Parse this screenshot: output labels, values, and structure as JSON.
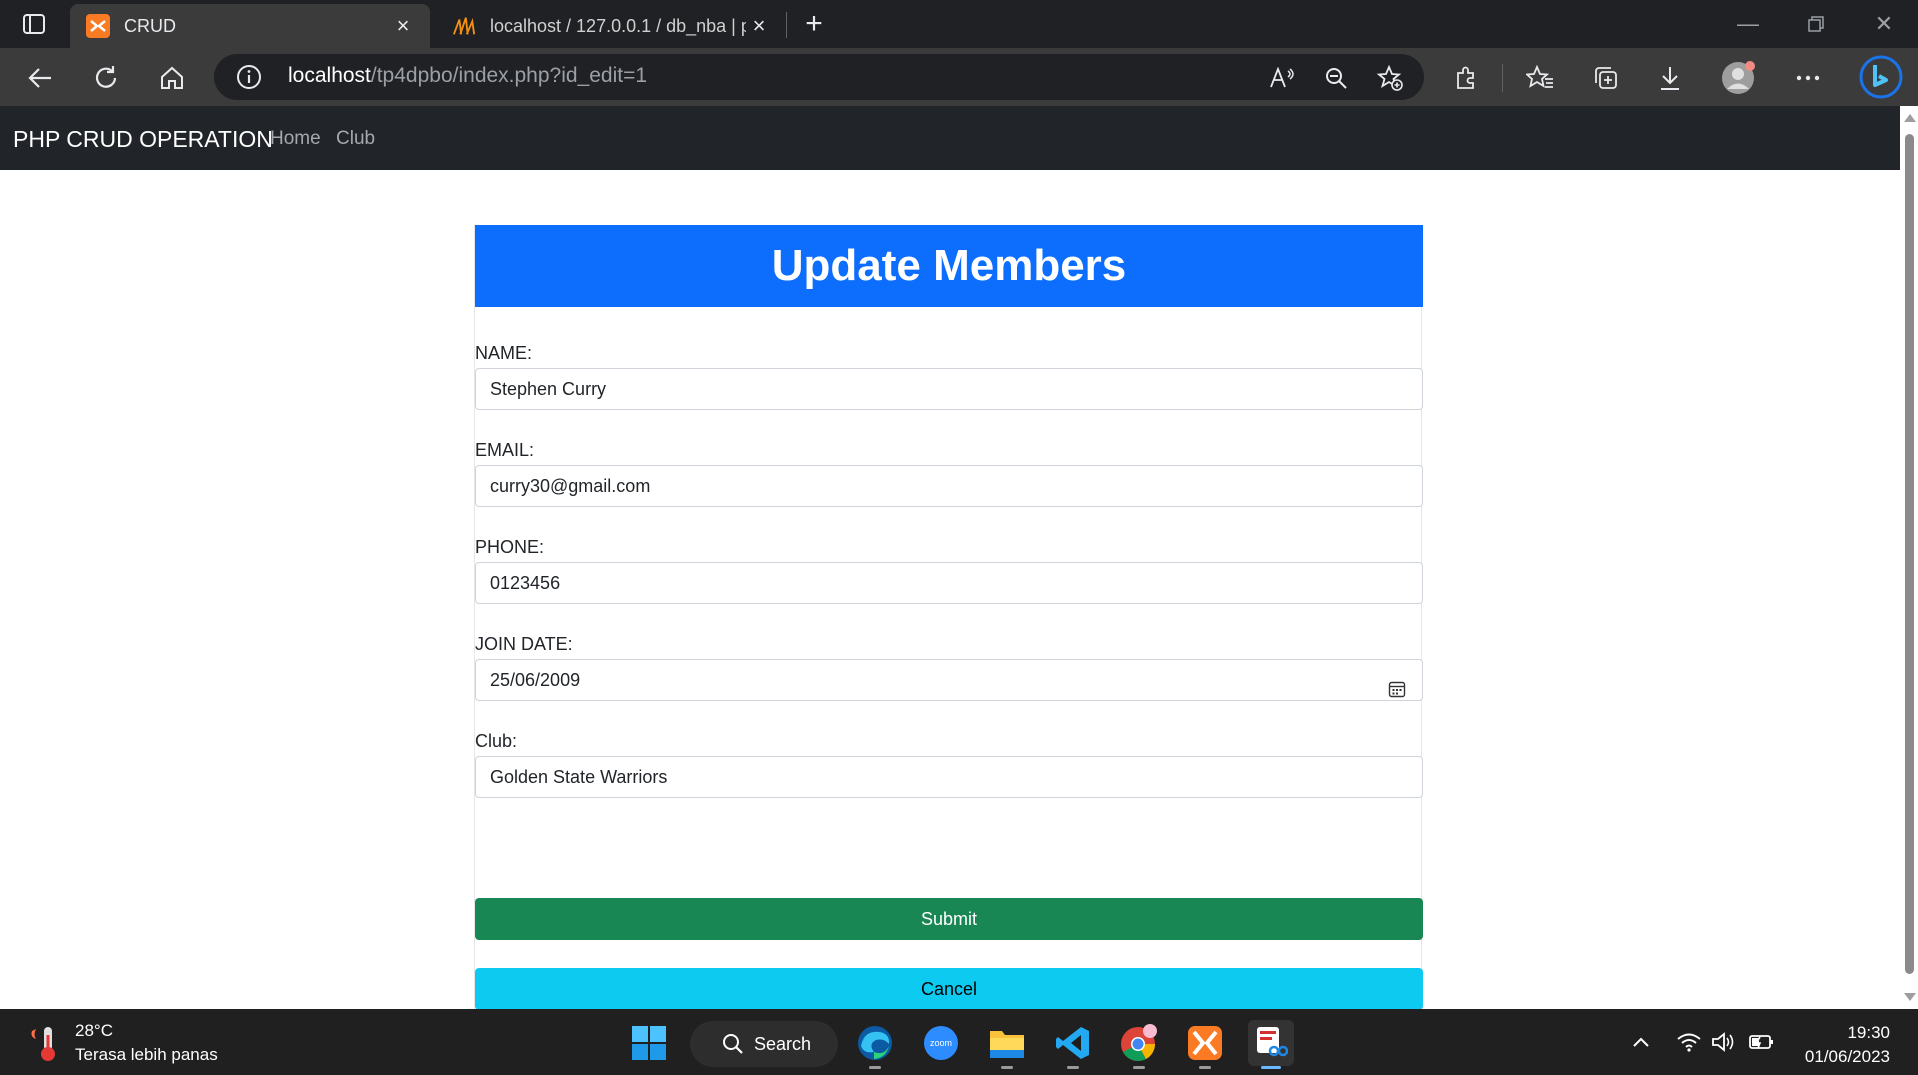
{
  "browser": {
    "tabs": [
      {
        "title": "CRUD",
        "active": true
      },
      {
        "title": "localhost / 127.0.0.1 / db_nba | p",
        "active": false
      }
    ],
    "address": {
      "host": "localhost",
      "path": "/tp4dpbo/index.php?id_edit=1"
    }
  },
  "site": {
    "brand": "PHP CRUD OPERATION",
    "nav_links": [
      "Home",
      "Club"
    ]
  },
  "form": {
    "title": "Update Members",
    "fields": [
      {
        "label": "NAME:",
        "value": "Stephen Curry"
      },
      {
        "label": "EMAIL:",
        "value": "curry30@gmail.com"
      },
      {
        "label": "PHONE:",
        "value": "0123456"
      },
      {
        "label": "JOIN DATE:",
        "value": "25/06/2009"
      },
      {
        "label": "Club:",
        "value": "Golden State Warriors"
      }
    ],
    "submit_label": "Submit",
    "cancel_label": "Cancel"
  },
  "taskbar": {
    "weather_temp": "28°C",
    "weather_desc": "Terasa lebih panas",
    "search_label": "Search",
    "apps": [
      "windows-start",
      "edge",
      "zoom",
      "file-explorer",
      "vscode",
      "chrome",
      "xampp",
      "snipping-tool"
    ],
    "time": "19:30",
    "date": "01/06/2023"
  },
  "colors": {
    "primary": "#0d6efd",
    "success": "#198754",
    "info": "#0dcaf0",
    "navbar_dark": "#212529"
  }
}
